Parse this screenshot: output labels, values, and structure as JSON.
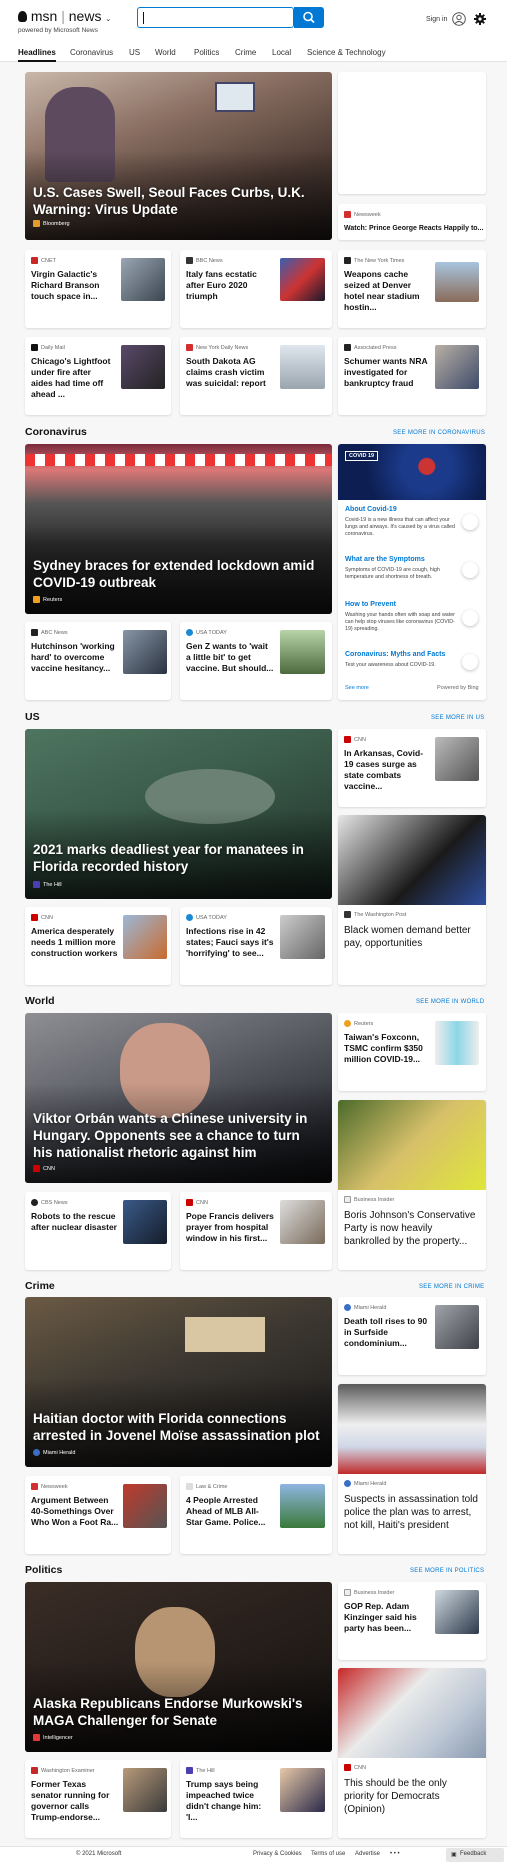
{
  "header": {
    "logo_msn": "msn",
    "logo_news": "news",
    "powered": "powered by Microsoft News",
    "search_placeholder": "",
    "signin": "Sign in"
  },
  "nav": [
    "Headlines",
    "Coronavirus",
    "US",
    "World",
    "Politics",
    "Crime",
    "Local",
    "Science & Technology"
  ],
  "top": {
    "hero": {
      "title": "U.S. Cases Swell, Seoul Faces Curbs, U.K. Warning: Virus Update",
      "source": "Bloomberg"
    },
    "side": {
      "source": "Newsweek",
      "title": "Watch: Prince George Reacts Happily to..."
    },
    "row1": [
      {
        "source": "CNET",
        "title": "Virgin Galactic's Richard Branson touch space in..."
      },
      {
        "source": "BBC News",
        "title": "Italy fans ecstatic after Euro 2020 triumph"
      },
      {
        "source": "The New York Times",
        "title": "Weapons cache seized at Denver hotel near stadium hostin..."
      }
    ],
    "row2": [
      {
        "source": "Daily Mail",
        "title": "Chicago's Lightfoot under fire after aides had time off ahead ..."
      },
      {
        "source": "New York Daily News",
        "title": "South Dakota AG claims crash victim was suicidal: report"
      },
      {
        "source": "Associated Press",
        "title": "Schumer wants NRA investigated for bankruptcy fraud"
      }
    ]
  },
  "corona": {
    "heading": "Coronavirus",
    "see_more": "SEE MORE IN CORONAVIRUS",
    "hero": {
      "title": "Sydney braces for extended lockdown amid COVID-19 outbreak",
      "source": "Reuters"
    },
    "cards": [
      {
        "source": "ABC News",
        "title": "Hutchinson 'working hard' to overcome vaccine hesitancy..."
      },
      {
        "source": "USA TODAY",
        "title": "Gen Z wants to 'wait a little bit' to get vaccine. But should..."
      }
    ],
    "panel": {
      "badge": "COVID 19",
      "items": [
        {
          "title": "About Covid-19",
          "text": "Covid-19 is a new illness that can affect your lungs and airways. It's caused by a virus called coronavirus."
        },
        {
          "title": "What are the Symptoms",
          "text": "Symptoms of COVID-19 are cough, high temperature and shortness of breath."
        },
        {
          "title": "How to Prevent",
          "text": "Washing your hands often with soap and water can help stop viruses like coronavirus (COVID-19) spreading."
        },
        {
          "title": "Coronavirus: Myths and Facts",
          "text": "Test your awareness about COVID-19."
        }
      ],
      "see_more": "See more",
      "powered": "Powered by Bing"
    }
  },
  "us": {
    "heading": "US",
    "see_more": "SEE MORE IN US",
    "hero": {
      "title": "2021 marks deadliest year for manatees in Florida recorded history",
      "source": "The Hill"
    },
    "side": {
      "source": "CNN",
      "title": "In Arkansas, Covid-19 cases surge as state combats vaccine..."
    },
    "side2": {
      "source": "The Washington Post",
      "title": "Black women demand better pay, opportunities"
    },
    "cards": [
      {
        "source": "CNN",
        "title": "America desperately needs 1 million more construction workers"
      },
      {
        "source": "USA TODAY",
        "title": "Infections rise in 42 states; Fauci says it's 'horrifying' to see..."
      }
    ]
  },
  "world": {
    "heading": "World",
    "see_more": "SEE MORE IN WORLD",
    "hero": {
      "title": "Viktor Orbán wants a Chinese university in Hungary. Opponents see a chance to turn his nationalist rhetoric against him",
      "source": "CNN"
    },
    "side": {
      "source": "Reuters",
      "title": "Taiwan's Foxconn, TSMC confirm $350 million COVID-19..."
    },
    "side2": {
      "source": "Business Insider",
      "title": "Boris Johnson's Conservative Party is now heavily bankrolled by the property..."
    },
    "cards": [
      {
        "source": "CBS News",
        "title": "Robots to the rescue after nuclear disaster"
      },
      {
        "source": "CNN",
        "title": "Pope Francis delivers prayer from hospital window in his first..."
      }
    ]
  },
  "crime": {
    "heading": "Crime",
    "see_more": "SEE MORE IN CRIME",
    "hero": {
      "title": "Haitian doctor with Florida connections arrested in Jovenel Moïse assassination plot",
      "source": "Miami Herald"
    },
    "side": {
      "source": "Miami Herald",
      "title": "Death toll rises to 90 in Surfside condominium..."
    },
    "side2": {
      "source": "Miami Herald",
      "title": "Suspects in assassination told police the plan was to arrest, not kill, Haiti's president"
    },
    "cards": [
      {
        "source": "Newsweek",
        "title": "Argument Between 40-Somethings Over Who Won a Foot Ra..."
      },
      {
        "source": "Law & Crime",
        "title": "4 People Arrested Ahead of MLB All-Star Game. Police..."
      }
    ]
  },
  "politics": {
    "heading": "Politics",
    "see_more": "SEE MORE IN POLITICS",
    "hero": {
      "title": "Alaska Republicans Endorse Murkowski's MAGA Challenger for Senate",
      "source": "Intelligencer"
    },
    "side": {
      "source": "Business Insider",
      "title": "GOP Rep. Adam Kinzinger said his party has been..."
    },
    "side2": {
      "source": "CNN",
      "title": "This should be the only priority for Democrats (Opinion)"
    },
    "cards": [
      {
        "source": "Washington Examiner",
        "title": "Former Texas senator running for governor calls Trump-endorse..."
      },
      {
        "source": "The Hill",
        "title": "Trump says being impeached twice didn't change him: 'I..."
      }
    ]
  },
  "footer": {
    "copyright": "© 2021 Microsoft",
    "privacy": "Privacy & Cookies",
    "terms": "Terms of use",
    "advertise": "Advertise",
    "more": "• • •",
    "feedback": "Feedback"
  }
}
